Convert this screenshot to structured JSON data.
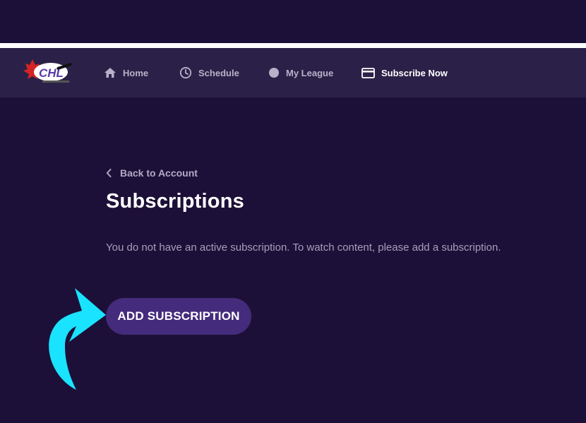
{
  "header": {
    "logo_text": "CHL"
  },
  "nav": {
    "items": [
      {
        "label": "Home",
        "icon": "home-icon"
      },
      {
        "label": "Schedule",
        "icon": "clock-icon"
      },
      {
        "label": "My League",
        "icon": "circle-icon"
      },
      {
        "label": "Subscribe Now",
        "icon": "card-icon",
        "active": true
      }
    ]
  },
  "main": {
    "back_label": "Back to Account",
    "title": "Subscriptions",
    "message": "You do not have an active subscription. To watch content, please add a subscription.",
    "add_button_label": "ADD SUBSCRIPTION"
  },
  "colors": {
    "background": "#1d1038",
    "navbar": "#2b2148",
    "button": "#452b7c",
    "arrow": "#19e3ff"
  }
}
